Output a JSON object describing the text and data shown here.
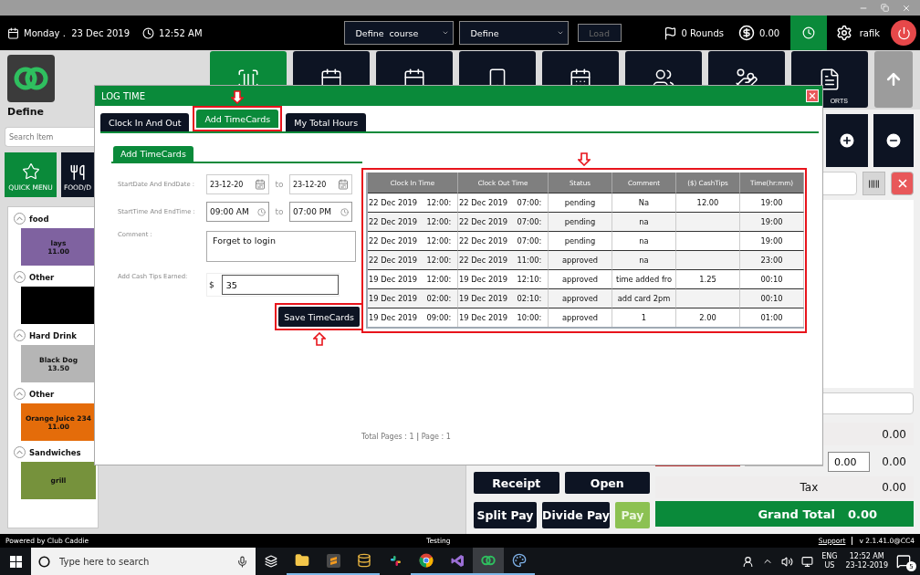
{
  "header": {
    "date": "Monday .  23 Dec 2019",
    "time": "12:52 AM",
    "course_select": "Define  course",
    "mode_select": "Define",
    "load_button": "Load",
    "rounds": "0 Rounds",
    "balance": "0.00",
    "clock_active": true,
    "user": "rafik"
  },
  "sidebar": {
    "brand": "Define",
    "search": {
      "placeholder": "Search Item"
    },
    "menu_tiles": [
      {
        "label": "QUICK MENU",
        "kind": "star",
        "selected": true
      },
      {
        "label": "FOOD/D",
        "kind": "food",
        "selected": false
      }
    ],
    "categories": [
      {
        "name": "food",
        "items": [
          {
            "name": "lays",
            "price": "11.00",
            "color": "#7f62a0"
          }
        ]
      },
      {
        "name": "Other",
        "items": [
          {
            "color": "#000000"
          }
        ]
      },
      {
        "name": "Hard Drink",
        "items": [
          {
            "name": "Black Dog",
            "price": "13.50",
            "color": "#b5b5b5"
          }
        ]
      },
      {
        "name": "Other",
        "items": [
          {
            "name": "Orange Juice 234",
            "price": "11.00",
            "color": "#e46c0a"
          }
        ]
      },
      {
        "name": "Sandwiches",
        "items": [
          {
            "name": "grill",
            "color": "#76923c"
          }
        ]
      }
    ]
  },
  "nav_tiles": [
    {
      "kind": "scanner",
      "selected": true
    },
    {
      "kind": "calendar",
      "selected": false
    },
    {
      "kind": "calendar",
      "selected": false
    },
    {
      "kind": "badge",
      "selected": false
    },
    {
      "kind": "schedule",
      "selected": false
    },
    {
      "kind": "people",
      "selected": false
    },
    {
      "kind": "payment",
      "selected": false
    },
    {
      "kind": "report",
      "label": "ORTS",
      "selected": false
    }
  ],
  "order_panel": {
    "subtotal": "0.00",
    "discount_input": "0.00",
    "discount": "0.00",
    "tax_label": "Tax",
    "tax": "0.00",
    "grand_total_label": "Grand Total",
    "grand_total": "0.00",
    "buttons": [
      {
        "label": "Receipt",
        "kind": "dark"
      },
      {
        "label": "Open",
        "kind": "dark"
      },
      {
        "label": "Split Pay",
        "kind": "dark"
      },
      {
        "label": "Divide Pay",
        "kind": "dark"
      },
      {
        "label": "Pay",
        "kind": "pay"
      }
    ]
  },
  "dialog": {
    "title": "LOG TIME",
    "tabs": [
      {
        "label": "Clock In And Out",
        "selected": false
      },
      {
        "label": "Add TimeCards",
        "selected": true,
        "annotated": true,
        "arrow_above": true
      },
      {
        "label": "My Total Hours",
        "selected": false
      }
    ],
    "section_tab": "Add TimeCards",
    "form": {
      "date_label": "StartDate And EndDate :",
      "start_date": "23-12-20",
      "end_date": "23-12-20",
      "to_1": "to",
      "time_label": "StartTime And EndTime :",
      "start_time": "09:00 AM",
      "end_time": "07:00 PM",
      "to_2": "to",
      "comment_label": "Comment :",
      "comment": "Forget to login",
      "tips_label": "Add Cash Tips Earned:",
      "currency": "$",
      "tips": "35",
      "save_button": "Save TimeCards",
      "save_annotated": true,
      "save_arrow_above": false
    },
    "table": {
      "annotated": true,
      "arrow_above": true,
      "columns": [
        "Clock In Time",
        "Clock Out Time",
        "Status",
        "Comment",
        "($) CashTips",
        "Time(hr:mm)"
      ],
      "rows": [
        [
          "22 Dec 2019    12:00:",
          "22 Dec 2019    07:00:",
          "pending",
          "Na",
          "12.00",
          "19:00"
        ],
        [
          "22 Dec 2019    12:00:",
          "22 Dec 2019    07:00:",
          "pending",
          "na",
          "",
          "19:00"
        ],
        [
          "22 Dec 2019    12:00:",
          "22 Dec 2019    07:00:",
          "pending",
          "na",
          "",
          "19:00"
        ],
        [
          "22 Dec 2019    12:00:",
          "22 Dec 2019    11:00:",
          "approved",
          "na",
          "",
          "23:00"
        ],
        [
          "19 Dec 2019    12:00:",
          "19 Dec 2019    12:10:",
          "approved",
          "time added fro",
          "1.25",
          "00:10"
        ],
        [
          "19 Dec 2019    02:00:",
          "19 Dec 2019    02:10:",
          "approved",
          "add card 2pm",
          "",
          "00:10"
        ],
        [
          "19 Dec 2019    09:00:",
          "19 Dec 2019    10:00:",
          "approved",
          "1",
          "2.00",
          "01:00"
        ]
      ]
    },
    "pagination": "Total Pages : 1 **|** Page : 1"
  },
  "status_bar": {
    "left": "Powered by Club Caddie",
    "center": "Testing",
    "support_link": "Support",
    "version": "v 2.1.41.0@CC4"
  },
  "taskbar": {
    "search": {
      "placeholder": "Type here to search"
    },
    "apps": [
      {
        "kind": "files",
        "running": true,
        "selected": false
      },
      {
        "kind": "sublime",
        "running": true,
        "selected": false
      },
      {
        "kind": "database",
        "running": true,
        "selected": false
      },
      {
        "kind": "slack",
        "running": false,
        "selected": false
      },
      {
        "kind": "chrome",
        "running": true,
        "selected": false
      },
      {
        "kind": "studio",
        "running": true,
        "selected": false
      },
      {
        "kind": "caddie",
        "running": true,
        "selected": true
      },
      {
        "kind": "paint",
        "running": true,
        "selected": false
      }
    ],
    "language": "ENG",
    "region": "US",
    "time": "12:52 AM",
    "date": "23-12-2019",
    "notifications": "5"
  }
}
